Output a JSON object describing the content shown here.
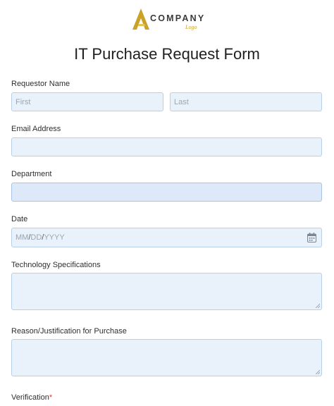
{
  "logo": {
    "word": "COMPANY",
    "sub": "Logo",
    "colors": {
      "gold": "#c9a227",
      "text": "#3a3a3a"
    }
  },
  "form": {
    "title": "IT Purchase Request Form",
    "requestor": {
      "label": "Requestor Name",
      "first_placeholder": "First",
      "last_placeholder": "Last"
    },
    "email": {
      "label": "Email Address",
      "value": ""
    },
    "department": {
      "label": "Department",
      "value": ""
    },
    "date": {
      "label": "Date",
      "placeholder_mm": "MM",
      "sep1": "/",
      "placeholder_dd": "DD",
      "sep2": "/",
      "placeholder_yyyy": "YYYY",
      "icon": "calendar-icon"
    },
    "tech_specs": {
      "label": "Technology Specifications",
      "value": ""
    },
    "reason": {
      "label": "Reason/Justification for Purchase",
      "value": ""
    },
    "verification": {
      "label": "Verification",
      "required_mark": "*"
    }
  },
  "colors": {
    "field_bg": "#e9f2fb",
    "field_border": "#b9cfe6",
    "required": "#e53935"
  }
}
